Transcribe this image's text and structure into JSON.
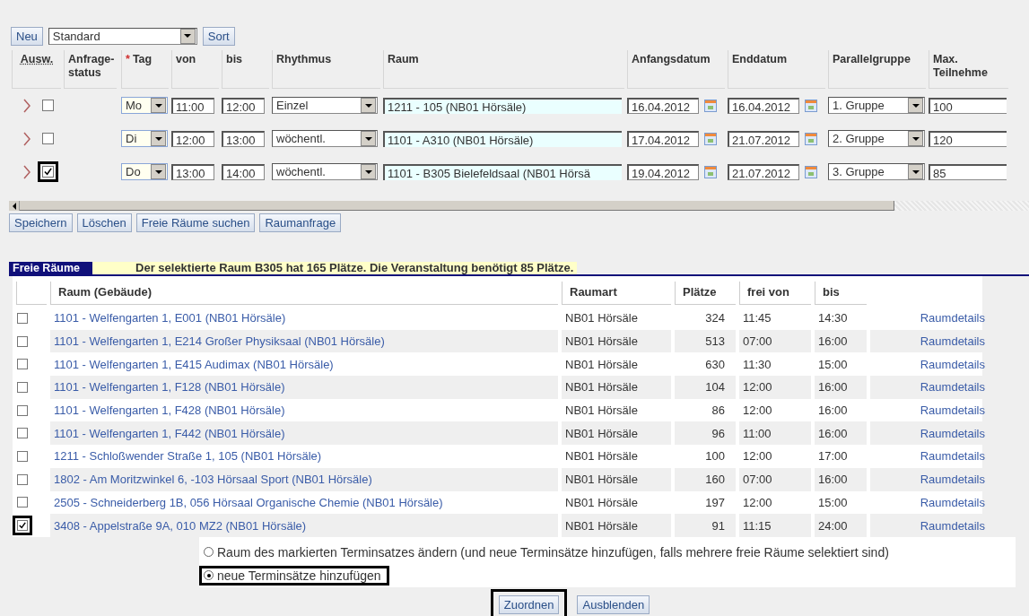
{
  "toolbar": {
    "new_button": "Neu",
    "view_select": "Standard",
    "sort_button": "Sort"
  },
  "schedule": {
    "columns": [
      {
        "label": "Ausw."
      },
      {
        "label": "Anfrage-status"
      },
      {
        "label": "Tag",
        "marker": "*"
      },
      {
        "label": "von"
      },
      {
        "label": "bis"
      },
      {
        "label": "Rhythmus"
      },
      {
        "label": "Raum"
      },
      {
        "label": "Anfangsdatum"
      },
      {
        "label": "Enddatum"
      },
      {
        "label": "Parallelgruppe"
      },
      {
        "label": "Max. Teilnehme"
      }
    ],
    "rows": [
      {
        "selected": false,
        "highlighted": false,
        "day": "Mo",
        "from": "11:00",
        "to": "12:00",
        "rhythm": "Einzel",
        "room": "1211 - 105 (NB01 Hörsäle)",
        "start_date": "16.04.2012",
        "end_date": "16.04.2012",
        "group": "1. Gruppe",
        "max_participants": "100"
      },
      {
        "selected": false,
        "highlighted": false,
        "day": "Di",
        "from": "12:00",
        "to": "13:00",
        "rhythm": "wöchentl.",
        "room": "1101 - A310 (NB01 Hörsäle)",
        "start_date": "17.04.2012",
        "end_date": "21.07.2012",
        "group": "2. Gruppe",
        "max_participants": "120"
      },
      {
        "selected": true,
        "highlighted": true,
        "day": "Do",
        "from": "13:00",
        "to": "14:00",
        "rhythm": "wöchentl.",
        "room": "1101 - B305 Bielefeldsaal (NB01 Hörsä",
        "start_date": "19.04.2012",
        "end_date": "21.07.2012",
        "group": "3. Gruppe",
        "max_participants": "85"
      }
    ]
  },
  "actions": [
    "Speichern",
    "Löschen",
    "Freie Räume suchen",
    "Raumanfrage"
  ],
  "free_rooms": {
    "title": "Freie Räume",
    "message": "Der selektierte Raum B305 hat 165 Plätze. Die Veranstaltung benötigt 85 Plätze.",
    "columns": [
      "Raum (Gebäude)",
      "Raumart",
      "Plätze",
      "frei von",
      "bis"
    ],
    "rows": [
      {
        "selected": false,
        "highlighted": false,
        "room": "1101 - Welfengarten 1, E001 (NB01 Hörsäle)",
        "type": "NB01 Hörsäle",
        "seats": "324",
        "free_from": "11:45",
        "until": "14:30",
        "link": "Raumdetails"
      },
      {
        "selected": false,
        "highlighted": false,
        "room": "1101 - Welfengarten 1, E214 Großer Physiksaal (NB01 Hörsäle)",
        "type": "NB01 Hörsäle",
        "seats": "513",
        "free_from": "07:00",
        "until": "16:00",
        "link": "Raumdetails"
      },
      {
        "selected": false,
        "highlighted": false,
        "room": "1101 - Welfengarten 1, E415 Audimax (NB01 Hörsäle)",
        "type": "NB01 Hörsäle",
        "seats": "630",
        "free_from": "11:30",
        "until": "15:00",
        "link": "Raumdetails"
      },
      {
        "selected": false,
        "highlighted": false,
        "room": "1101 - Welfengarten 1, F128 (NB01 Hörsäle)",
        "type": "NB01 Hörsäle",
        "seats": "104",
        "free_from": "12:00",
        "until": "16:00",
        "link": "Raumdetails"
      },
      {
        "selected": false,
        "highlighted": false,
        "room": "1101 - Welfengarten 1, F428 (NB01 Hörsäle)",
        "type": "NB01 Hörsäle",
        "seats": "86",
        "free_from": "12:00",
        "until": "16:00",
        "link": "Raumdetails"
      },
      {
        "selected": false,
        "highlighted": false,
        "room": "1101 - Welfengarten 1, F442 (NB01 Hörsäle)",
        "type": "NB01 Hörsäle",
        "seats": "96",
        "free_from": "11:00",
        "until": "16:00",
        "link": "Raumdetails"
      },
      {
        "selected": false,
        "highlighted": false,
        "room": "1211 - Schloßwender Straße 1, 105 (NB01 Hörsäle)",
        "type": "NB01 Hörsäle",
        "seats": "100",
        "free_from": "12:00",
        "until": "17:00",
        "link": "Raumdetails"
      },
      {
        "selected": false,
        "highlighted": false,
        "room": "1802 - Am Moritzwinkel 6, -103 Hörsaal Sport (NB01 Hörsäle)",
        "type": "NB01 Hörsäle",
        "seats": "160",
        "free_from": "07:00",
        "until": "16:00",
        "link": "Raumdetails"
      },
      {
        "selected": false,
        "highlighted": false,
        "room": "2505 - Schneiderberg 1B, 056 Hörsaal Organische Chemie (NB01 Hörsäle)",
        "type": "NB01 Hörsäle",
        "seats": "197",
        "free_from": "12:00",
        "until": "15:00",
        "link": "Raumdetails"
      },
      {
        "selected": true,
        "highlighted": true,
        "room": "3408 - Appelstraße 9A, 010 MZ2 (NB01 Hörsäle)",
        "type": "NB01 Hörsäle",
        "seats": "91",
        "free_from": "11:15",
        "until": "24:00",
        "link": "Raumdetails"
      }
    ]
  },
  "options": [
    {
      "label": "Raum des markierten Terminsatzes ändern (und neue Terminsätze hinzufügen, falls mehrere freie Räume selektiert sind)",
      "selected": false,
      "highlighted": false
    },
    {
      "label": "neue Terminsätze hinzufügen",
      "selected": true,
      "highlighted": true
    }
  ],
  "buttons": [
    {
      "label": "Zuordnen",
      "highlighted": true
    },
    {
      "label": "Ausblenden",
      "highlighted": false
    }
  ]
}
